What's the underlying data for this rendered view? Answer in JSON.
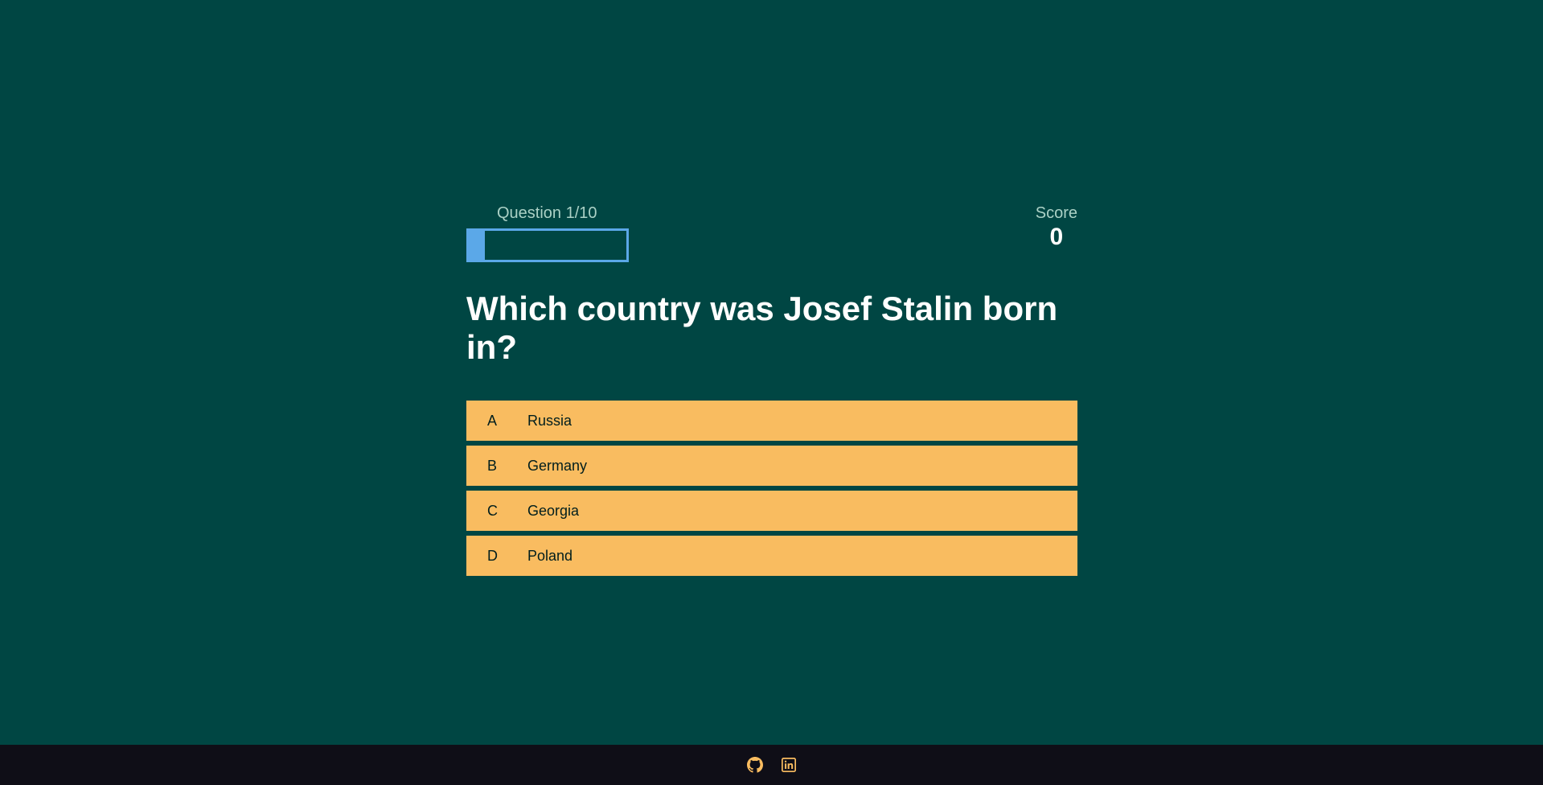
{
  "hud": {
    "progress_text": "Question 1/10",
    "progress_fraction": 0.1,
    "score_label": "Score",
    "score_value": "0"
  },
  "question": {
    "text": "Which country was Josef Stalin born in?"
  },
  "choices": [
    {
      "prefix": "A",
      "text": "Russia"
    },
    {
      "prefix": "B",
      "text": "Germany"
    },
    {
      "prefix": "C",
      "text": "Georgia"
    },
    {
      "prefix": "D",
      "text": "Poland"
    }
  ],
  "footer": {
    "icons": [
      "github-icon",
      "linkedin-icon"
    ]
  },
  "colors": {
    "background": "#004643",
    "choice_background": "#f9bc60",
    "progress": "#5ba8e8",
    "footer_background": "#0f0e17",
    "footer_icon": "#f9bc60"
  }
}
